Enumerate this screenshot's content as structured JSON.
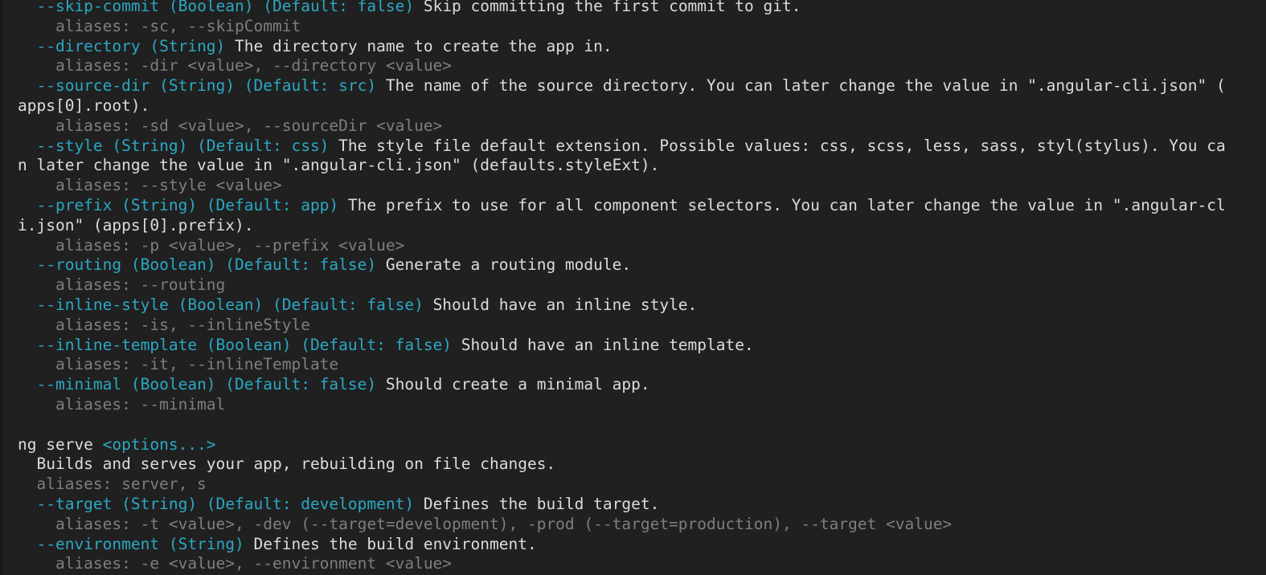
{
  "terminal": {
    "title": "ng help output",
    "colors": {
      "background": "#202020",
      "foreground": "#dcdcdc",
      "cyan": "#2aa8c4",
      "dim_gray": "#7e7e7e",
      "edge_shade": "#151515"
    },
    "font_size_px": 19.5,
    "line_height_px": 24.8,
    "columns": 127
  },
  "lines": [
    {
      "id": "l01",
      "segments": [
        {
          "text": "  ",
          "style": "white"
        },
        {
          "text": "--skip-commit (Boolean) (Default: false)",
          "style": "cyan"
        },
        {
          "text": " Skip committing the first commit to git.",
          "style": "white"
        }
      ]
    },
    {
      "id": "l02",
      "segments": [
        {
          "text": "    aliases: -sc, --skipCommit",
          "style": "gray"
        }
      ]
    },
    {
      "id": "l03",
      "segments": [
        {
          "text": "  ",
          "style": "white"
        },
        {
          "text": "--directory (String)",
          "style": "cyan"
        },
        {
          "text": " The directory name to create the app in.",
          "style": "white"
        }
      ]
    },
    {
      "id": "l04",
      "segments": [
        {
          "text": "    aliases: -dir <value>, --directory <value>",
          "style": "gray"
        }
      ]
    },
    {
      "id": "l05",
      "segments": [
        {
          "text": "  ",
          "style": "white"
        },
        {
          "text": "--source-dir (String) (Default: src)",
          "style": "cyan"
        },
        {
          "text": " The name of the source directory. You can later change the value in \".angular-cli.json\" (",
          "style": "white"
        }
      ]
    },
    {
      "id": "l06",
      "segments": [
        {
          "text": "apps[0].root).",
          "style": "white"
        }
      ]
    },
    {
      "id": "l07",
      "segments": [
        {
          "text": "    aliases: -sd <value>, --sourceDir <value>",
          "style": "gray"
        }
      ]
    },
    {
      "id": "l08",
      "segments": [
        {
          "text": "  ",
          "style": "white"
        },
        {
          "text": "--style (String) (Default: css)",
          "style": "cyan"
        },
        {
          "text": " The style file default extension. Possible values: css, scss, less, sass, styl(stylus). You ca",
          "style": "white"
        }
      ]
    },
    {
      "id": "l09",
      "segments": [
        {
          "text": "n later change the value in \".angular-cli.json\" (defaults.styleExt).",
          "style": "white"
        }
      ]
    },
    {
      "id": "l10",
      "segments": [
        {
          "text": "    aliases: --style <value>",
          "style": "gray"
        }
      ]
    },
    {
      "id": "l11",
      "segments": [
        {
          "text": "  ",
          "style": "white"
        },
        {
          "text": "--prefix (String) (Default: app)",
          "style": "cyan"
        },
        {
          "text": " The prefix to use for all component selectors. You can later change the value in \".angular-cl",
          "style": "white"
        }
      ]
    },
    {
      "id": "l12",
      "segments": [
        {
          "text": "i.json\" (apps[0].prefix).",
          "style": "white"
        }
      ]
    },
    {
      "id": "l13",
      "segments": [
        {
          "text": "    aliases: -p <value>, --prefix <value>",
          "style": "gray"
        }
      ]
    },
    {
      "id": "l14",
      "segments": [
        {
          "text": "  ",
          "style": "white"
        },
        {
          "text": "--routing (Boolean) (Default: false)",
          "style": "cyan"
        },
        {
          "text": " Generate a routing module.",
          "style": "white"
        }
      ]
    },
    {
      "id": "l15",
      "segments": [
        {
          "text": "    aliases: --routing",
          "style": "gray"
        }
      ]
    },
    {
      "id": "l16",
      "segments": [
        {
          "text": "  ",
          "style": "white"
        },
        {
          "text": "--inline-style (Boolean) (Default: false)",
          "style": "cyan"
        },
        {
          "text": " Should have an inline style.",
          "style": "white"
        }
      ]
    },
    {
      "id": "l17",
      "segments": [
        {
          "text": "    aliases: -is, --inlineStyle",
          "style": "gray"
        }
      ]
    },
    {
      "id": "l18",
      "segments": [
        {
          "text": "  ",
          "style": "white"
        },
        {
          "text": "--inline-template (Boolean) (Default: false)",
          "style": "cyan"
        },
        {
          "text": " Should have an inline template.",
          "style": "white"
        }
      ]
    },
    {
      "id": "l19",
      "segments": [
        {
          "text": "    aliases: -it, --inlineTemplate",
          "style": "gray"
        }
      ]
    },
    {
      "id": "l20",
      "segments": [
        {
          "text": "  ",
          "style": "white"
        },
        {
          "text": "--minimal (Boolean) (Default: false)",
          "style": "cyan"
        },
        {
          "text": " Should create a minimal app.",
          "style": "white"
        }
      ]
    },
    {
      "id": "l21",
      "segments": [
        {
          "text": "    aliases: --minimal",
          "style": "gray"
        }
      ]
    },
    {
      "id": "l22",
      "segments": [
        {
          "text": "",
          "style": "white"
        }
      ]
    },
    {
      "id": "l23",
      "segments": [
        {
          "text": "ng serve ",
          "style": "white"
        },
        {
          "text": "<options...>",
          "style": "cyan"
        }
      ]
    },
    {
      "id": "l24",
      "segments": [
        {
          "text": "  Builds and serves your app, rebuilding on file changes.",
          "style": "white"
        }
      ]
    },
    {
      "id": "l25",
      "segments": [
        {
          "text": "  aliases: server, s",
          "style": "gray"
        }
      ]
    },
    {
      "id": "l26",
      "segments": [
        {
          "text": "  ",
          "style": "white"
        },
        {
          "text": "--target (String) (Default: development)",
          "style": "cyan"
        },
        {
          "text": " Defines the build target.",
          "style": "white"
        }
      ]
    },
    {
      "id": "l27",
      "segments": [
        {
          "text": "    aliases: -t <value>, -dev (--target=development), -prod (--target=production), --target <value>",
          "style": "gray"
        }
      ]
    },
    {
      "id": "l28",
      "segments": [
        {
          "text": "  ",
          "style": "white"
        },
        {
          "text": "--environment (String)",
          "style": "cyan"
        },
        {
          "text": " Defines the build environment.",
          "style": "white"
        }
      ]
    },
    {
      "id": "l29",
      "segments": [
        {
          "text": "    aliases: -e <value>, --environment <value>",
          "style": "gray"
        }
      ]
    }
  ]
}
